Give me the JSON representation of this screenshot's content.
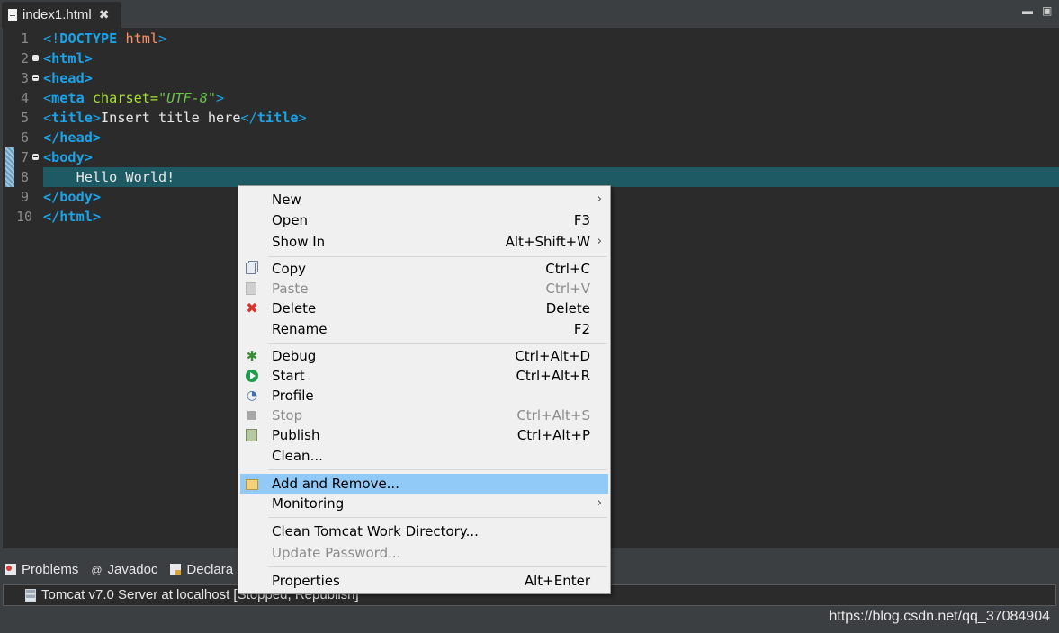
{
  "editor_tab": {
    "title": "index1.html",
    "close": "✖"
  },
  "window_controls": {
    "minimize": "▬",
    "maximize": "▣"
  },
  "code": {
    "line_numbers": [
      "1",
      "2",
      "3",
      "4",
      "5",
      "6",
      "7",
      "8",
      "9",
      "10"
    ],
    "l1_a": "<!",
    "l1_b": "DOCTYPE",
    "l1_c": " html",
    "l1_d": ">",
    "l2": "<html>",
    "l3": "<head>",
    "l4_a": "<",
    "l4_b": "meta",
    "l4_c": " charset=",
    "l4_d": "\"UTF-8\"",
    "l4_e": ">",
    "l5_a": "<",
    "l5_b": "title",
    "l5_c": ">",
    "l5_d": "Insert title here",
    "l5_e": "</",
    "l5_f": "title",
    "l5_g": ">",
    "l6": "</head>",
    "l7": "<body>",
    "l8": "    Hello World!",
    "l9": "</body>",
    "l10": "</html>"
  },
  "bottom_tabs": {
    "problems": "Problems",
    "javadoc": "Javadoc",
    "declaration": "Declara",
    "javadoc_icon": "@"
  },
  "server": {
    "label": "Tomcat v7.0 Server at localhost  [Stopped, Republish]"
  },
  "watermark": "https://blog.csdn.net/qq_37084904",
  "context_menu": {
    "new": {
      "label": "New"
    },
    "open": {
      "label": "Open",
      "shortcut": "F3"
    },
    "show_in": {
      "label": "Show In",
      "shortcut": "Alt+Shift+W"
    },
    "copy": {
      "label": "Copy",
      "shortcut": "Ctrl+C"
    },
    "paste": {
      "label": "Paste",
      "shortcut": "Ctrl+V"
    },
    "delete": {
      "label": "Delete",
      "shortcut": "Delete"
    },
    "rename": {
      "label": "Rename",
      "shortcut": "F2"
    },
    "debug": {
      "label": "Debug",
      "shortcut": "Ctrl+Alt+D"
    },
    "start": {
      "label": "Start",
      "shortcut": "Ctrl+Alt+R"
    },
    "profile": {
      "label": "Profile"
    },
    "stop": {
      "label": "Stop",
      "shortcut": "Ctrl+Alt+S"
    },
    "publish": {
      "label": "Publish",
      "shortcut": "Ctrl+Alt+P"
    },
    "clean": {
      "label": "Clean..."
    },
    "add_remove": {
      "label": "Add and Remove..."
    },
    "monitoring": {
      "label": "Monitoring"
    },
    "clean_tomcat": {
      "label": "Clean Tomcat Work Directory..."
    },
    "update_password": {
      "label": "Update Password..."
    },
    "properties": {
      "label": "Properties",
      "shortcut": "Alt+Enter"
    },
    "submenu_arrow": "›"
  },
  "colors": {
    "highlight": "#91c9f7",
    "tag": "#1aa3e8",
    "attr": "#a7e22e",
    "value": "#6cc24a",
    "doctype": "#ff8f66"
  }
}
